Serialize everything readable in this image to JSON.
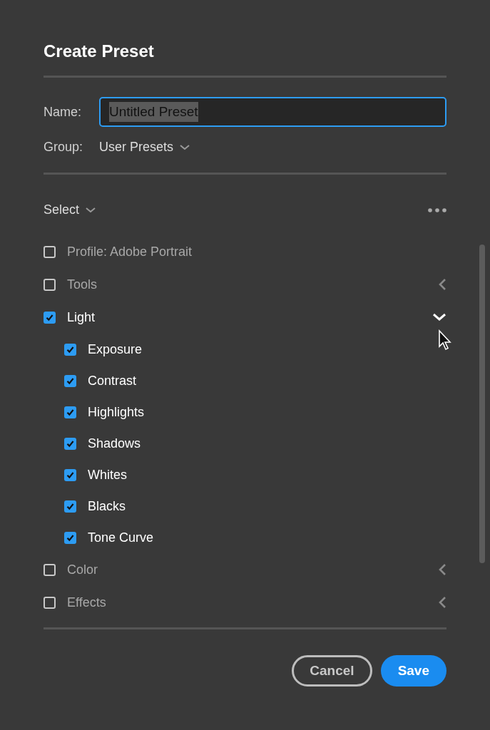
{
  "dialog": {
    "title": "Create Preset"
  },
  "name_field": {
    "label": "Name:",
    "value": "Untitled Preset",
    "focused": true,
    "value_selected": true
  },
  "group_field": {
    "label": "Group:",
    "value": "User Presets"
  },
  "select_menu": {
    "label": "Select"
  },
  "items": [
    {
      "kind": "plain",
      "label": "Profile: Adobe Portrait",
      "checked": false
    },
    {
      "kind": "group",
      "label": "Tools",
      "checked": false,
      "expanded": false
    },
    {
      "kind": "group",
      "label": "Light",
      "checked": true,
      "expanded": true,
      "children": [
        {
          "label": "Exposure",
          "checked": true
        },
        {
          "label": "Contrast",
          "checked": true
        },
        {
          "label": "Highlights",
          "checked": true
        },
        {
          "label": "Shadows",
          "checked": true
        },
        {
          "label": "Whites",
          "checked": true
        },
        {
          "label": "Blacks",
          "checked": true
        },
        {
          "label": "Tone Curve",
          "checked": true
        }
      ]
    },
    {
      "kind": "group",
      "label": "Color",
      "checked": false,
      "expanded": false
    },
    {
      "kind": "group",
      "label": "Effects",
      "checked": false,
      "expanded": false
    }
  ],
  "buttons": [
    {
      "kind": "secondary",
      "label": "Cancel"
    },
    {
      "kind": "primary",
      "label": "Save"
    }
  ]
}
